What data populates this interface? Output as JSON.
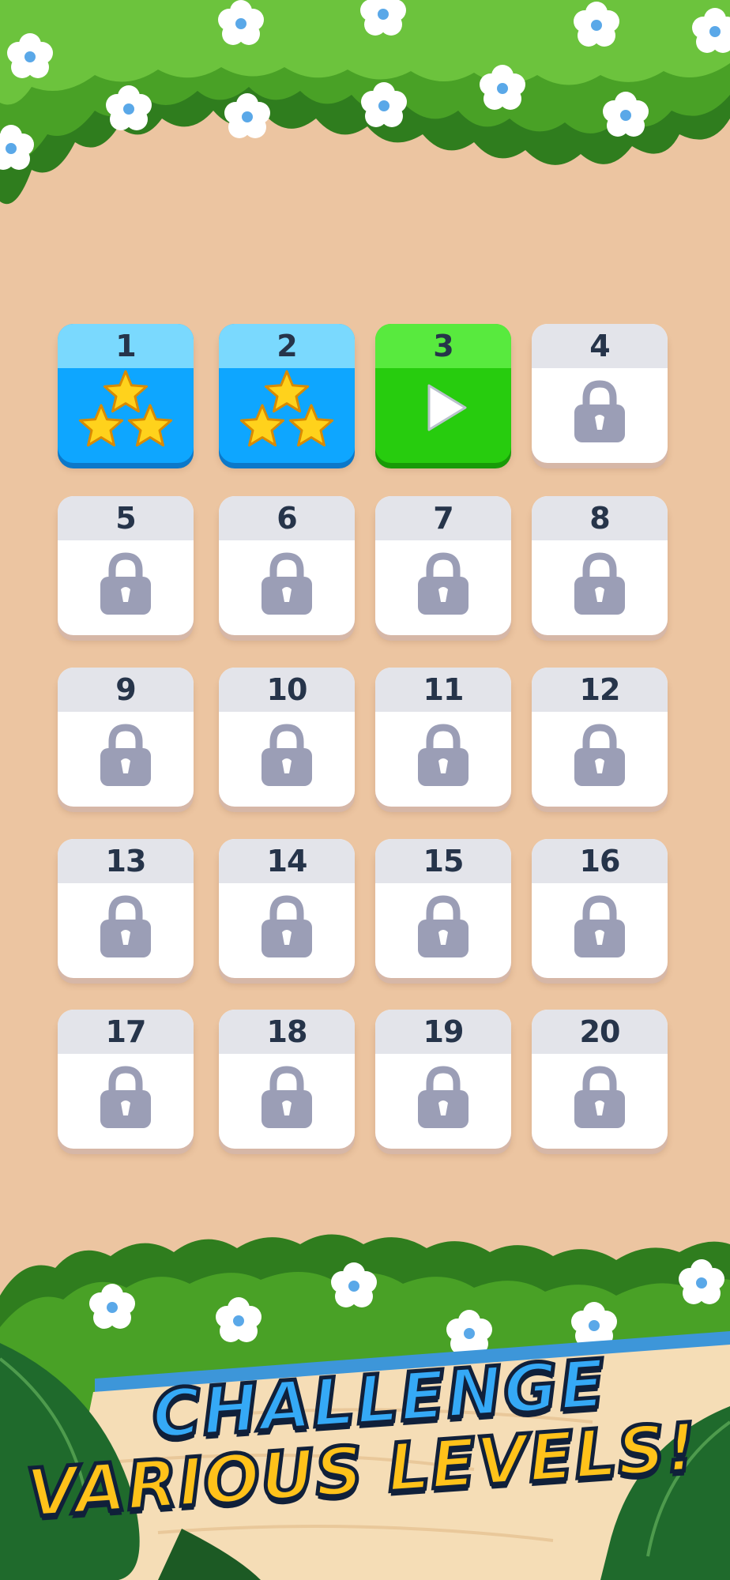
{
  "levels": [
    {
      "number": "1",
      "state": "completed",
      "stars": 3
    },
    {
      "number": "2",
      "state": "completed",
      "stars": 3
    },
    {
      "number": "3",
      "state": "current"
    },
    {
      "number": "4",
      "state": "locked"
    },
    {
      "number": "5",
      "state": "locked"
    },
    {
      "number": "6",
      "state": "locked"
    },
    {
      "number": "7",
      "state": "locked"
    },
    {
      "number": "8",
      "state": "locked"
    },
    {
      "number": "9",
      "state": "locked"
    },
    {
      "number": "10",
      "state": "locked"
    },
    {
      "number": "11",
      "state": "locked"
    },
    {
      "number": "12",
      "state": "locked"
    },
    {
      "number": "13",
      "state": "locked"
    },
    {
      "number": "14",
      "state": "locked"
    },
    {
      "number": "15",
      "state": "locked"
    },
    {
      "number": "16",
      "state": "locked"
    },
    {
      "number": "17",
      "state": "locked"
    },
    {
      "number": "18",
      "state": "locked"
    },
    {
      "number": "19",
      "state": "locked"
    },
    {
      "number": "20",
      "state": "locked"
    }
  ],
  "banner": {
    "line1": "CHALLENGE",
    "line2": "VARIOUS LEVELS!"
  },
  "icons": {
    "completed": "star-icon",
    "current": "play-icon",
    "locked": "lock-icon"
  },
  "colors": {
    "background": "#ecc5a1",
    "completed": "#0ea6ff",
    "current": "#27cc0e",
    "locked": "#ffffff",
    "lock": "#9b9eb6",
    "star": "#ffd21c"
  }
}
